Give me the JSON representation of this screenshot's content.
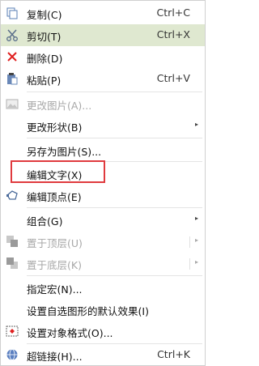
{
  "menu": {
    "copy": {
      "label": "复制(C)",
      "shortcut": "Ctrl+C"
    },
    "cut": {
      "label": "剪切(T)",
      "shortcut": "Ctrl+X"
    },
    "delete": {
      "label": "删除(D)"
    },
    "paste": {
      "label": "粘贴(P)",
      "shortcut": "Ctrl+V"
    },
    "change_image": {
      "label": "更改图片(A)..."
    },
    "change_shape": {
      "label": "更改形状(B)"
    },
    "save_as_image": {
      "label": "另存为图片(S)..."
    },
    "edit_text": {
      "label": "编辑文字(X)"
    },
    "edit_points": {
      "label": "编辑顶点(E)"
    },
    "group": {
      "label": "组合(G)"
    },
    "bring_to_front": {
      "label": "置于顶层(U)"
    },
    "send_to_back": {
      "label": "置于底层(K)"
    },
    "assign_macro": {
      "label": "指定宏(N)..."
    },
    "set_default_effect": {
      "label": "设置自选图形的默认效果(I)"
    },
    "format_object": {
      "label": "设置对象格式(O)..."
    },
    "hyperlink": {
      "label": "超链接(H)...",
      "shortcut": "Ctrl+K"
    }
  },
  "colors": {
    "hover_bg": "#dfe8d0",
    "highlight_border": "#e03a3e",
    "disabled_text": "#a8a8a8"
  }
}
